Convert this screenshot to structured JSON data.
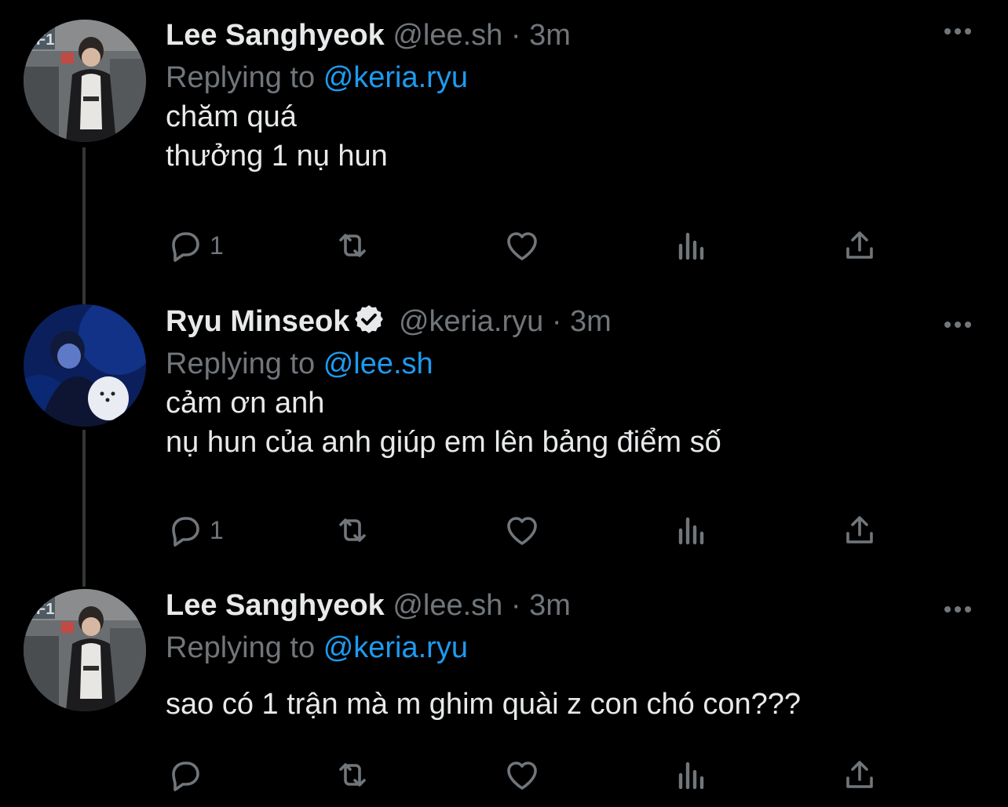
{
  "tweets": [
    {
      "name": "Lee Sanghyeok",
      "handle": "@lee.sh",
      "separator": "·",
      "time": "3m",
      "verified": false,
      "replying_prefix": "Replying to",
      "replying_to": "@keria.ryu",
      "text_lines": [
        "chăm quá",
        "thưởng 1 nụ hun"
      ],
      "reply_count": "1",
      "avatar": "faker-avatar"
    },
    {
      "name": "Ryu Minseok",
      "handle": "@keria.ryu",
      "separator": "·",
      "time": "3m",
      "verified": true,
      "replying_prefix": "Replying to",
      "replying_to": "@lee.sh",
      "text_lines": [
        "cảm ơn anh",
        "nụ hun của anh giúp em lên bảng điểm số"
      ],
      "reply_count": "1",
      "avatar": "keria-avatar"
    },
    {
      "name": "Lee Sanghyeok",
      "handle": "@lee.sh",
      "separator": "·",
      "time": "3m",
      "verified": false,
      "replying_prefix": "Replying to",
      "replying_to": "@keria.ryu",
      "text_lines": [
        "sao có 1 trận mà m ghim quài z con chó con???"
      ],
      "reply_count": "",
      "avatar": "faker-avatar"
    }
  ],
  "icons": {
    "reply": "reply-icon",
    "retweet": "retweet-icon",
    "like": "like-icon",
    "views": "views-icon",
    "share": "share-icon",
    "more": "more-icon",
    "verified": "verified-badge-icon"
  },
  "colors": {
    "background": "#000000",
    "text": "#e7e9ea",
    "muted": "#71767b",
    "accent": "#1d9bf0",
    "thread_line": "#333639"
  }
}
